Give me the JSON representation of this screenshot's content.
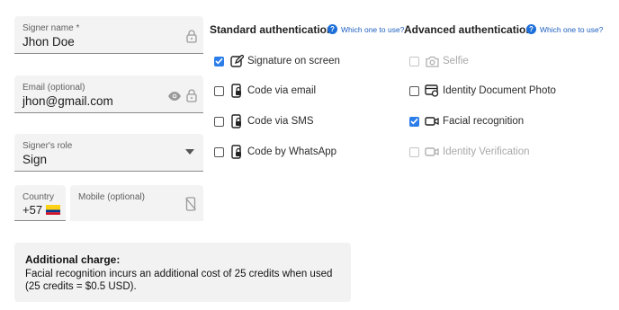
{
  "signer_name": {
    "label": "Signer name *",
    "value": "Jhon Doe"
  },
  "email": {
    "label": "Email (optional)",
    "value": "jhon@gmail.com"
  },
  "role": {
    "label": "Signer's role",
    "value": "Sign"
  },
  "country": {
    "label": "Country",
    "code": "+57",
    "flag": "colombia-flag"
  },
  "mobile": {
    "placeholder": "Mobile (optional)"
  },
  "standard": {
    "title": "Standard authentication",
    "help": "Which one to use?",
    "options": [
      {
        "label": "Signature on screen",
        "checked": true,
        "icon": "pen-icon"
      },
      {
        "label": "Code via email",
        "checked": false,
        "icon": "phone-lock-icon"
      },
      {
        "label": "Code via SMS",
        "checked": false,
        "icon": "phone-lock-icon"
      },
      {
        "label": "Code by WhatsApp",
        "checked": false,
        "icon": "phone-lock-icon"
      }
    ]
  },
  "advanced": {
    "title": "Advanced authentication",
    "help": "Which one to use?",
    "options": [
      {
        "label": "Selfie",
        "checked": false,
        "disabled": true,
        "icon": "camera-icon"
      },
      {
        "label": "Identity Document Photo",
        "checked": false,
        "icon": "id-card-icon"
      },
      {
        "label": "Facial recognition",
        "checked": true,
        "icon": "video-icon"
      },
      {
        "label": "Identity Verification",
        "checked": false,
        "disabled": true,
        "icon": "video-icon"
      }
    ]
  },
  "notice": {
    "title": "Additional charge:",
    "body": "Facial recognition incurs an additional cost of 25 credits when used (25 credits = $0.5 USD)."
  },
  "colors": {
    "accent": "#2b7de9",
    "help_link": "#1e5fbf",
    "field_bg": "#f3f3f3"
  }
}
